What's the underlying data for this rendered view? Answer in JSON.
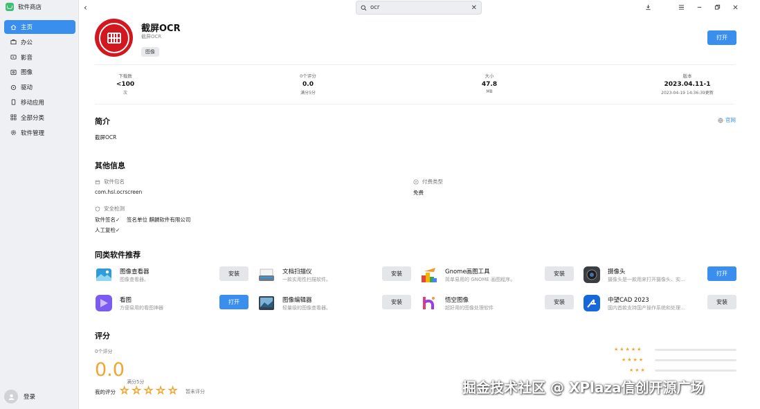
{
  "sidebar": {
    "brand": "软件商店",
    "items": [
      {
        "label": "主页",
        "icon": "home-icon",
        "active": true
      },
      {
        "label": "办公",
        "icon": "briefcase-icon"
      },
      {
        "label": "影音",
        "icon": "media-icon"
      },
      {
        "label": "图像",
        "icon": "image-icon"
      },
      {
        "label": "驱动",
        "icon": "driver-icon"
      },
      {
        "label": "移动应用",
        "icon": "mobile-icon"
      },
      {
        "label": "全部分类",
        "icon": "grid-icon"
      },
      {
        "label": "软件管理",
        "icon": "settings-icon"
      }
    ],
    "login": "登录"
  },
  "search": {
    "value": "ocr"
  },
  "app": {
    "name": "截屏OCR",
    "subtitle": "截屏OCR",
    "tag": "图像",
    "action": "打开"
  },
  "stats": [
    {
      "label": "下载数",
      "value": "<100",
      "unit": "次"
    },
    {
      "label": "0个评分",
      "value": "0.0",
      "unit": "满分5分"
    },
    {
      "label": "大小",
      "value": "47.8",
      "unit": "MB"
    },
    {
      "label": "版本",
      "value": "2023.04.11-1",
      "unit": "2023-04-19 14:36:39更新"
    }
  ],
  "intro": {
    "title": "简介",
    "text": "截屏OCR",
    "website": "官网"
  },
  "other": {
    "title": "其他信息",
    "package_label": "软件包名",
    "package_value": "com.hsl.ocrscreen",
    "pay_label": "付费类型",
    "pay_value": "免费",
    "security_label": "安全检测",
    "signature": "软件签名✓",
    "signer": "签名单位 麒麟软件有限公司",
    "manual": "人工复检✓"
  },
  "recommend": {
    "title": "同类软件推荐",
    "items": [
      {
        "name": "图像查看器",
        "desc": "图像查看器。",
        "button": "安装",
        "primary": false
      },
      {
        "name": "文档扫描仪",
        "desc": "一款实用性扫描软件。",
        "button": "安装",
        "primary": false
      },
      {
        "name": "Gnome画图工具",
        "desc": "简单易用的 GNOME 画图程序。",
        "button": "安装",
        "primary": false
      },
      {
        "name": "摄像头",
        "desc": "摄像头是一款用来打开摄像头、实…",
        "button": "打开",
        "primary": true
      },
      {
        "name": "看图",
        "desc": "方便易用的看图神器",
        "button": "打开",
        "primary": true
      },
      {
        "name": "图像编辑器",
        "desc": "轻量级的图像查看器。",
        "button": "安装",
        "primary": false
      },
      {
        "name": "悟空图像",
        "desc": "超好用的图像处理软件",
        "button": "安装",
        "primary": false
      },
      {
        "name": "中望CAD 2023",
        "desc": "国内首款支持国产操作系统和处理…",
        "button": "安装",
        "primary": false
      }
    ]
  },
  "rating": {
    "title": "评分",
    "count": "0个评分",
    "score": "0.0",
    "max": "满分5分",
    "my_label": "我的评分",
    "no_rating": "暂未评分",
    "stars": [
      5,
      4,
      3
    ]
  },
  "watermark": "掘金技术社区 @ XPlaza信创开源广场",
  "colors": {
    "accent": "#3a8fee",
    "star": "#f0a630",
    "logo_red": "#d2171e"
  }
}
